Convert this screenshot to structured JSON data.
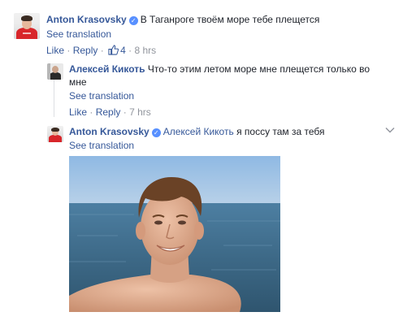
{
  "comment1": {
    "author": "Anton Krasovsky",
    "text": "В Таганроге твоём море тебе плещется",
    "see_translation": "See translation",
    "like": "Like",
    "separator": "·",
    "reply": "Reply",
    "like_count": "4",
    "time": "8 hrs"
  },
  "reply1": {
    "author": "Алексей Кикоть",
    "text_line1": "Что-то этим летом море мне плещется только во",
    "text_line2": "мне",
    "see_translation": "See translation",
    "like": "Like",
    "separator": "·",
    "reply": "Reply",
    "time": "7 hrs"
  },
  "reply2": {
    "author": "Anton Krasovsky",
    "mention": "Алексей Кикоть",
    "text": "я поссу там за тебя",
    "see_translation": "See translation",
    "photo_icon": "selfie-photo"
  },
  "colors": {
    "link": "#365899",
    "text": "#1d2129",
    "meta": "#90949c",
    "verified": "#5890ff",
    "sea": "#3f6f92",
    "sky": "#9fc3e6"
  },
  "icons": [
    "verified-badge-icon",
    "thumbs-up-icon",
    "chevron-down-icon"
  ]
}
